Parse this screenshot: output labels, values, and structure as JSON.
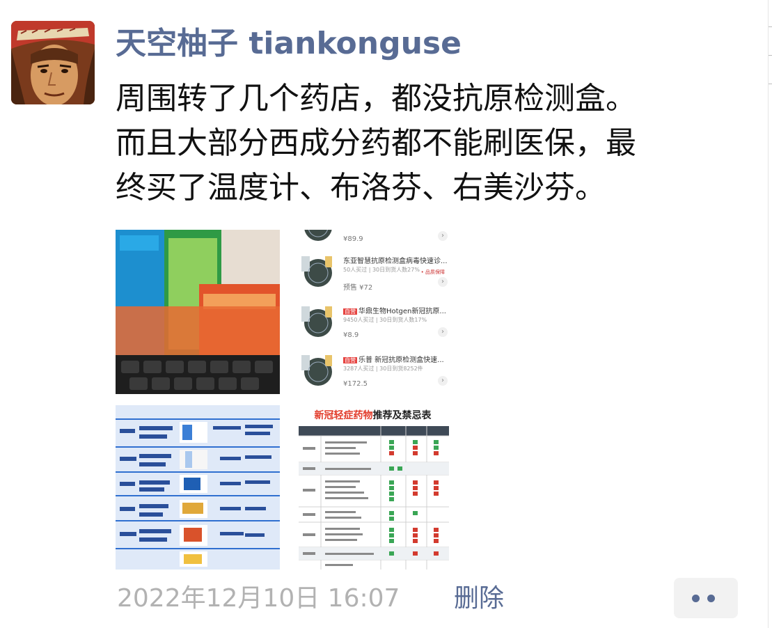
{
  "post": {
    "username": "天空柚子 tiankonguse",
    "text": "周围转了几个药店，都没抗原检测盒。\n而且大部分西成分药都不能刷医保，最\n终买了温度计、布洛芬、右美沙芬。",
    "date": "2022年12月10日 16:07",
    "delete_label": "删除"
  },
  "photos": {
    "listing": {
      "rows": [
        {
          "tag": "",
          "title": "",
          "sub": "",
          "price": "¥89.9",
          "badge": ""
        },
        {
          "tag": "",
          "title": "东亚智慧抗原检测盒病毒快速诊...",
          "sub": "50人买过 | 30日到货人数27%",
          "price": "预售 ¥72",
          "badge": "• 品质保障"
        },
        {
          "tag": "自营",
          "title": "华鼎生物Hotgen新冠抗原...",
          "sub": "9450人买过 | 30日到货人数17%",
          "price": "¥8.9",
          "badge": ""
        },
        {
          "tag": "自营",
          "title": "乐普 新冠抗原检测盒快速...",
          "sub": "3287人买过 | 30日到货8252件",
          "price": "¥172.5",
          "badge": ""
        }
      ]
    },
    "table": {
      "title_highlight": "新冠轻症药物",
      "title_rest": "推荐及禁忌表"
    }
  },
  "colors": {
    "link": "#586b94",
    "meta": "#b2b2b2",
    "text": "#111111"
  }
}
